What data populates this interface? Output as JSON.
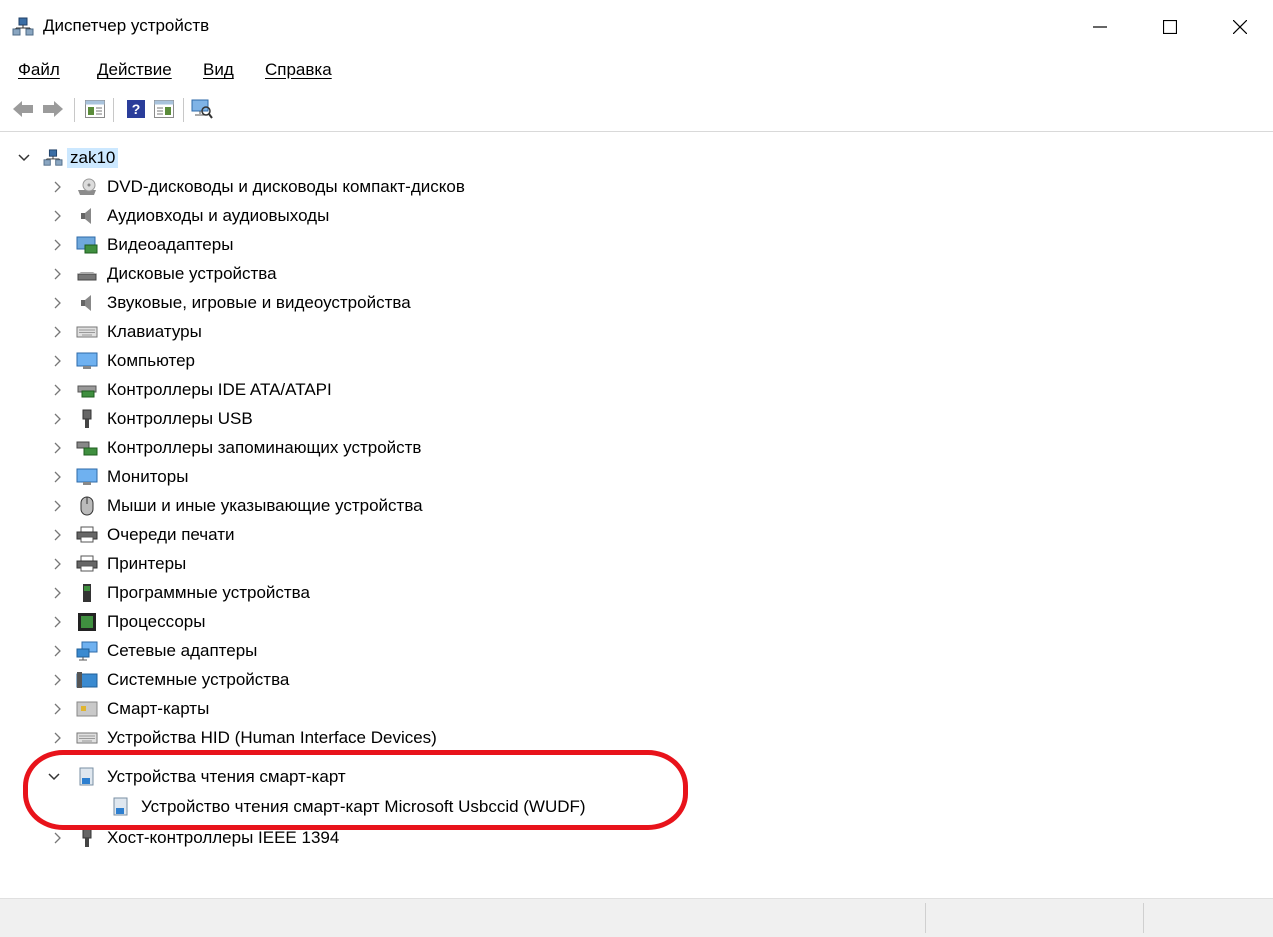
{
  "window": {
    "title": "Диспетчер устройств"
  },
  "menu": [
    "Файл",
    "Действие",
    "Вид",
    "Справка"
  ],
  "toolbar": {
    "buttons": [
      "back-arrow-icon",
      "forward-arrow-icon",
      "properties-icon",
      "help-icon",
      "update-driver-icon",
      "scan-hardware-icon"
    ]
  },
  "tree": {
    "root": "zak10",
    "categories": [
      "DVD-дисководы и дисководы компакт-дисков",
      "Аудиовходы и аудиовыходы",
      "Видеоадаптеры",
      "Дисковые устройства",
      "Звуковые, игровые и видеоустройства",
      "Клавиатуры",
      "Компьютер",
      "Контроллеры IDE ATA/ATAPI",
      "Контроллеры USB",
      "Контроллеры запоминающих устройств",
      "Мониторы",
      "Мыши и иные указывающие устройства",
      "Очереди печати",
      "Принтеры",
      "Программные устройства",
      "Процессоры",
      "Сетевые адаптеры",
      "Системные устройства",
      "Смарт-карты",
      "Устройства HID (Human Interface Devices)",
      "Устройства чтения смарт-карт",
      "Хост-контроллеры IEEE 1394"
    ],
    "expanded_child": "Устройство чтения смарт-карт Microsoft Usbccid (WUDF)"
  },
  "annotation": {
    "color": "#e8131b"
  }
}
